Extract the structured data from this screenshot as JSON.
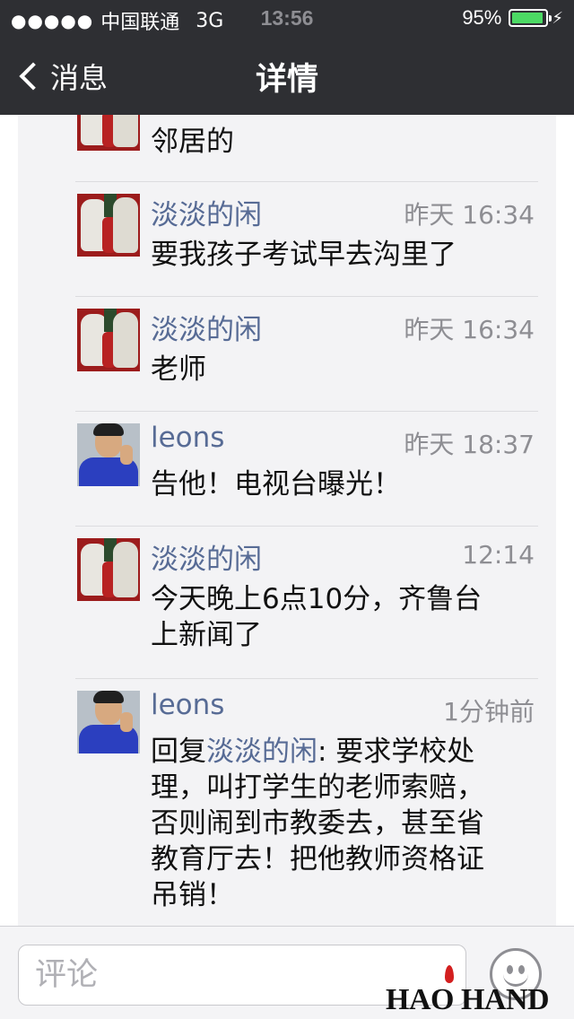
{
  "status_bar": {
    "signal": "●●●●●",
    "carrier": "中国联通",
    "network": "3G",
    "time": "13:56",
    "battery_percent": "95%",
    "battery_level": 0.95,
    "battery_color": "#4cd964"
  },
  "nav": {
    "back_label": "消息",
    "title": "详情"
  },
  "comments": [
    {
      "name": "",
      "time": "",
      "text": "邻居的",
      "avatar": "polar-bear-avatar"
    },
    {
      "name": "淡淡的闲",
      "time": "昨天 16:34",
      "text": "要我孩子考试早去沟里了",
      "avatar": "polar-bear-avatar"
    },
    {
      "name": "淡淡的闲",
      "time": "昨天 16:34",
      "text": "老师",
      "avatar": "polar-bear-avatar"
    },
    {
      "name": "leons",
      "time": "昨天 18:37",
      "text": "告他！电视台曝光！",
      "avatar": "person-avatar"
    },
    {
      "name": "淡淡的闲",
      "time": "12:14",
      "text_line1": "今天晚上6点10分，齐鲁台",
      "text_line2": "上新闻了",
      "avatar": "polar-bear-avatar"
    },
    {
      "name": "leons",
      "time": "1分钟前",
      "reply_prefix": "回复",
      "reply_to": "淡淡的闲",
      "reply_text": ": 要求学校处",
      "reply_line2": "理，叫打学生的老师索赔，",
      "reply_line3": "否则闹到市教委去，甚至省",
      "reply_line4": "教育厅去！把他教师资格证",
      "reply_line5": "吊销！",
      "avatar": "person-avatar"
    }
  ],
  "toolbar": {
    "comment_placeholder": "评论",
    "emoji_icon": "smiley-icon"
  },
  "watermark": {
    "text": "HAO HAND"
  },
  "colors": {
    "link": "#576b95",
    "header_bg": "#2e2f33"
  }
}
